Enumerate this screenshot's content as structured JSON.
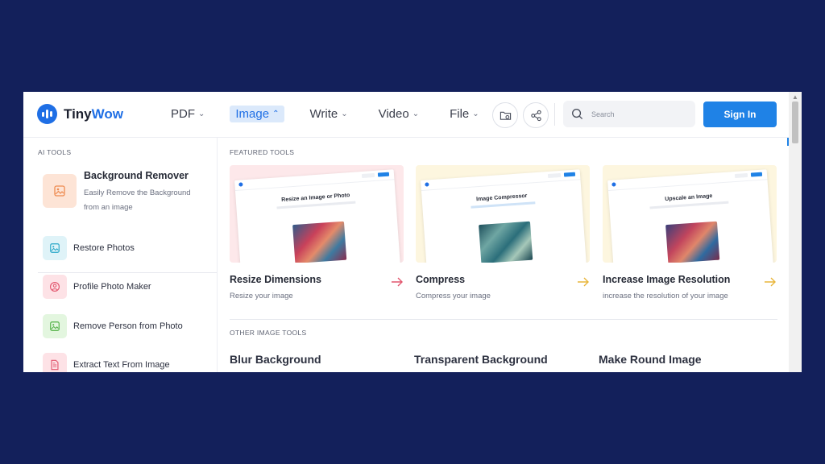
{
  "brand": {
    "name_part1": "Tiny",
    "name_part2": "Wow",
    "accent": "#1f6fe5"
  },
  "nav": {
    "items": [
      {
        "label": "PDF",
        "active": false
      },
      {
        "label": "Image",
        "active": true
      },
      {
        "label": "Write",
        "active": false
      },
      {
        "label": "Video",
        "active": false
      },
      {
        "label": "File",
        "active": false
      }
    ]
  },
  "header": {
    "folder_icon": "folder-icon",
    "share_icon": "share-icon",
    "search_placeholder": "Search",
    "signin_label": "Sign In"
  },
  "sidebar": {
    "title": "AI TOOLS",
    "featured": {
      "name": "Background Remover",
      "description": "Easily Remove the Background from an image",
      "icon": "image-icon"
    },
    "items": [
      {
        "label": "Restore Photos",
        "icon": "photo-icon",
        "bg": "#dff3f8",
        "fg": "#27a6c7"
      },
      {
        "label": "Profile Photo Maker",
        "icon": "person-icon",
        "bg": "#fde2e6",
        "fg": "#e2566e"
      },
      {
        "label": "Remove Person from Photo",
        "icon": "photo-icon",
        "bg": "#e3f6df",
        "fg": "#4fb043"
      },
      {
        "label": "Extract Text From Image",
        "icon": "document-icon",
        "bg": "#fde2e6",
        "fg": "#e2566e"
      }
    ]
  },
  "main": {
    "featured_title": "FEATURED TOOLS",
    "cards": [
      {
        "name": "Resize Dimensions",
        "description": "Resize your image",
        "mock_title": "Resize an Image or Photo",
        "bg": "#fde8ea",
        "arrow_color": "#e2566e"
      },
      {
        "name": "Compress",
        "description": "Compress your image",
        "mock_title": "Image Compressor",
        "bg": "#fdf6df",
        "arrow_color": "#e8b53a"
      },
      {
        "name": "Increase Image Resolution",
        "description": "increase the resolution of your image",
        "mock_title": "Upscale an Image",
        "bg": "#fdf6df",
        "arrow_color": "#e8b53a"
      }
    ],
    "other_title": "OTHER IMAGE TOOLS",
    "other_tools": [
      "Blur Background",
      "Transparent Background",
      "Make Round Image"
    ]
  }
}
